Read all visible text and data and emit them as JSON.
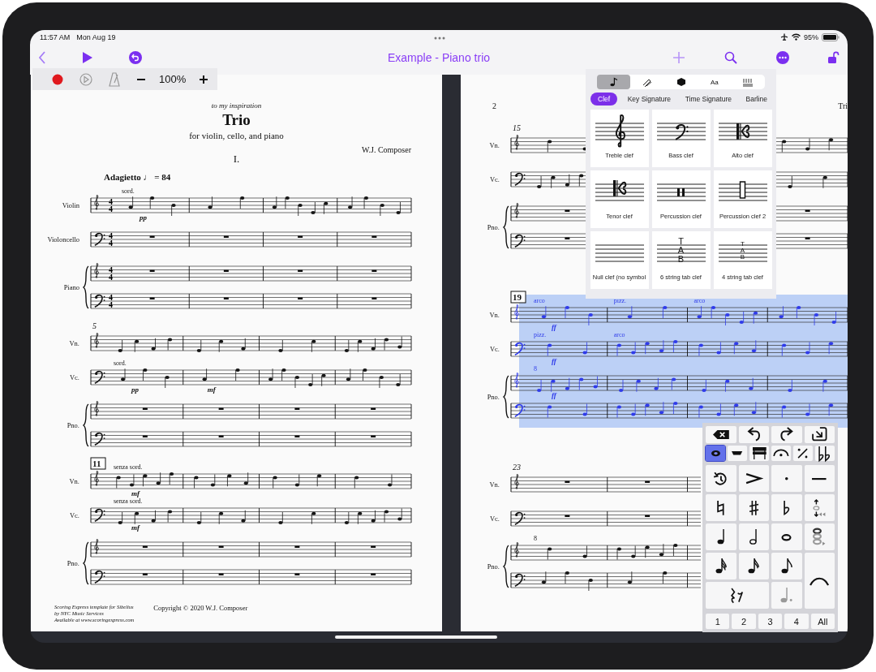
{
  "status_bar": {
    "time": "11:57 AM",
    "date": "Mon Aug 19",
    "battery": "95%"
  },
  "nav_bar": {
    "title": "Example - Piano trio"
  },
  "playback_bar": {
    "zoom": "100%"
  },
  "pages": [
    {
      "kind": "first",
      "dedication": "to my inspiration",
      "title": "Trio",
      "subtitle": "for violin, cello, and piano",
      "composer": "W.J. Composer",
      "movement": "I.",
      "systems": [
        {
          "tempo": "Adagietto ♩ = 84",
          "selected": false,
          "instruments": [
            {
              "name": "Violin",
              "staves": [
                {
                  "kind": "treble",
                  "has_notes": true,
                  "time_signature": [
                    "4",
                    "4"
                  ],
                  "above": [
                    {
                      "text": "sord.",
                      "kind": "technique"
                    }
                  ],
                  "below": [
                    {
                      "text": "pp",
                      "kind": "dynamic"
                    }
                  ]
                }
              ]
            },
            {
              "name": "Violoncello",
              "staves": [
                {
                  "kind": "bass",
                  "has_notes": false,
                  "time_signature": [
                    "4",
                    "4"
                  ]
                }
              ]
            },
            {
              "name": "Piano",
              "staves": [
                {
                  "kind": "treble",
                  "has_notes": false,
                  "time_signature": [
                    "4",
                    "4"
                  ]
                },
                {
                  "kind": "bass",
                  "has_notes": false,
                  "time_signature": [
                    "4",
                    "4"
                  ]
                }
              ]
            }
          ]
        },
        {
          "measure_number": {
            "text": "5",
            "boxed": false
          },
          "selected": false,
          "instruments": [
            {
              "name": "Vn.",
              "staves": [
                {
                  "kind": "treble",
                  "has_notes": true
                }
              ]
            },
            {
              "name": "Vc.",
              "staves": [
                {
                  "kind": "bass",
                  "has_notes": true,
                  "above": [
                    {
                      "text": "sord.",
                      "kind": "technique"
                    }
                  ],
                  "below": [
                    {
                      "text": "pp",
                      "kind": "dynamic"
                    },
                    {
                      "text": "mf",
                      "kind": "dynamic"
                    }
                  ]
                }
              ]
            },
            {
              "name": "Pno.",
              "staves": [
                {
                  "kind": "treble",
                  "has_notes": false
                },
                {
                  "kind": "bass",
                  "has_notes": false
                }
              ]
            }
          ]
        },
        {
          "measure_number": {
            "text": "11",
            "boxed": true
          },
          "selected": false,
          "instruments": [
            {
              "name": "Vn.",
              "staves": [
                {
                  "kind": "treble",
                  "has_notes": true,
                  "above": [
                    {
                      "text": "senza sord.",
                      "kind": "technique"
                    }
                  ],
                  "below": [
                    {
                      "text": "mf",
                      "kind": "dynamic"
                    }
                  ]
                }
              ]
            },
            {
              "name": "Vc.",
              "staves": [
                {
                  "kind": "bass",
                  "has_notes": true,
                  "above": [
                    {
                      "text": "senza sord.",
                      "kind": "technique"
                    }
                  ],
                  "below": [
                    {
                      "text": "mf",
                      "kind": "dynamic"
                    }
                  ]
                }
              ]
            },
            {
              "name": "Pno.",
              "staves": [
                {
                  "kind": "treble",
                  "has_notes": false
                },
                {
                  "kind": "bass",
                  "has_notes": false
                }
              ]
            }
          ]
        }
      ],
      "footer": {
        "credit_lines": [
          "Scoring Express template for Sibelius",
          "by NYC Music Services",
          "Available at www.scoringexpress.com"
        ],
        "copyright": "Copyright © 2020 W.J. Composer"
      }
    },
    {
      "kind": "continuation",
      "page_number": "2",
      "running_title": "Tri",
      "systems": [
        {
          "measure_number": {
            "text": "15",
            "boxed": false
          },
          "selected": false,
          "instruments": [
            {
              "name": "Vn.",
              "staves": [
                {
                  "kind": "treble",
                  "has_notes": true
                }
              ]
            },
            {
              "name": "Vc.",
              "staves": [
                {
                  "kind": "bass",
                  "has_notes": true
                }
              ]
            },
            {
              "name": "Pno.",
              "staves": [
                {
                  "kind": "treble",
                  "has_notes": false
                },
                {
                  "kind": "bass",
                  "has_notes": false
                }
              ]
            }
          ]
        },
        {
          "measure_number": {
            "text": "19",
            "boxed": true
          },
          "selected": true,
          "instruments": [
            {
              "name": "Vn.",
              "staves": [
                {
                  "kind": "treble",
                  "has_notes": true,
                  "above": [
                    {
                      "text": "arco",
                      "kind": "technique"
                    },
                    {
                      "text": "pizz.",
                      "kind": "technique"
                    },
                    {
                      "text": "arco",
                      "kind": "technique"
                    }
                  ],
                  "below": [
                    {
                      "text": "ff",
                      "kind": "dynamic"
                    }
                  ]
                }
              ]
            },
            {
              "name": "Vc.",
              "staves": [
                {
                  "kind": "bass",
                  "has_notes": true,
                  "above": [
                    {
                      "text": "pizz.",
                      "kind": "technique"
                    },
                    {
                      "text": "arco",
                      "kind": "technique"
                    }
                  ],
                  "below": [
                    {
                      "text": "ff",
                      "kind": "dynamic"
                    }
                  ]
                }
              ]
            },
            {
              "name": "Pno.",
              "staves": [
                {
                  "kind": "treble",
                  "has_notes": true,
                  "above": [
                    {
                      "text": "8",
                      "kind": "technique"
                    }
                  ],
                  "below": [
                    {
                      "text": "ff",
                      "kind": "dynamic"
                    }
                  ]
                },
                {
                  "kind": "bass",
                  "has_notes": true
                }
              ]
            }
          ]
        },
        {
          "measure_number": {
            "text": "23",
            "boxed": false
          },
          "selected": false,
          "instruments": [
            {
              "name": "Vn.",
              "staves": [
                {
                  "kind": "treble",
                  "has_notes": false
                }
              ]
            },
            {
              "name": "Vc.",
              "staves": [
                {
                  "kind": "bass",
                  "has_notes": false
                }
              ]
            },
            {
              "name": "Pno.",
              "staves": [
                {
                  "kind": "treble",
                  "has_notes": true,
                  "above": [
                    {
                      "text": "8",
                      "kind": "technique"
                    }
                  ]
                },
                {
                  "kind": "bass",
                  "has_notes": true
                }
              ]
            }
          ]
        }
      ]
    }
  ],
  "palette": {
    "icon_tabs": [
      {
        "kind": "note",
        "selected": true
      },
      {
        "kind": "pen",
        "selected": false
      },
      {
        "kind": "shape",
        "selected": false
      },
      {
        "kind": "text",
        "label": "Aa",
        "selected": false
      },
      {
        "kind": "keyboard",
        "selected": false
      }
    ],
    "categories": [
      {
        "label": "Clef",
        "selected": true
      },
      {
        "label": "Key Signature",
        "selected": false
      },
      {
        "label": "Time Signature",
        "selected": false
      },
      {
        "label": "Barline",
        "selected": false
      }
    ],
    "items": [
      {
        "kind": "treble",
        "label": "Treble clef"
      },
      {
        "kind": "bass",
        "label": "Bass clef"
      },
      {
        "kind": "alto",
        "label": "Alto clef"
      },
      {
        "kind": "tenor",
        "label": "Tenor clef"
      },
      {
        "kind": "percussion",
        "label": "Percussion clef"
      },
      {
        "kind": "percussion2",
        "label": "Percussion clef 2"
      },
      {
        "kind": "none",
        "label": "Null clef (no symbol"
      },
      {
        "kind": "tab6",
        "label": "6 string tab clef",
        "letters": [
          "T",
          "A",
          "B"
        ]
      },
      {
        "kind": "tab4",
        "label": "4 string tab clef",
        "letters": [
          "T",
          "A",
          "B"
        ]
      }
    ]
  },
  "keypad": {
    "actions": [
      {
        "kind": "delete"
      },
      {
        "kind": "undo"
      },
      {
        "kind": "redo"
      },
      {
        "kind": "enter"
      }
    ],
    "layouts": [
      {
        "kind": "notehead",
        "selected": true
      },
      {
        "kind": "tenuto-bar",
        "selected": false
      },
      {
        "kind": "beams",
        "selected": false
      },
      {
        "kind": "fermata",
        "selected": false
      },
      {
        "kind": "repeat",
        "selected": false
      },
      {
        "kind": "double-flat",
        "selected": false
      }
    ],
    "keys": [
      {
        "kind": "reset"
      },
      {
        "kind": "accent"
      },
      {
        "kind": "staccato"
      },
      {
        "kind": "tenuto"
      },
      {
        "kind": "natural"
      },
      {
        "kind": "sharp"
      },
      {
        "kind": "flat"
      },
      {
        "kind": "flip"
      },
      {
        "kind": "quarter"
      },
      {
        "kind": "half"
      },
      {
        "kind": "whole"
      },
      {
        "kind": "chord"
      },
      {
        "kind": "sixtyfourth"
      },
      {
        "kind": "thirtysecond"
      },
      {
        "kind": "eighth"
      },
      {
        "kind": "slur"
      },
      {
        "kind": "rests"
      },
      {
        "kind": "dot"
      }
    ],
    "voices": [
      {
        "label": "1"
      },
      {
        "label": "2"
      },
      {
        "label": "3"
      },
      {
        "label": "4"
      },
      {
        "label": "All"
      }
    ]
  }
}
